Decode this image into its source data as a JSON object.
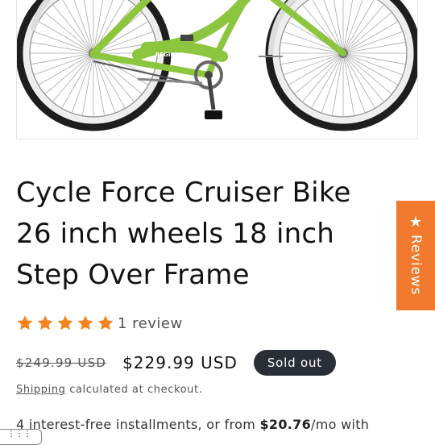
{
  "product": {
    "image_alt": "Green cruiser bicycle",
    "frame_logo": "REGIONS",
    "title": "Cycle Force Cruiser Bike 26 inch wheels 18 inch Step Over Frame",
    "rating": {
      "stars": 5,
      "max": 5,
      "review_count_label": "1 review"
    },
    "price": {
      "compare_at": "$249.99 USD",
      "sale": "$229.99 USD",
      "badge": "Sold out"
    },
    "shipping": {
      "link_label": "Shipping",
      "suffix": " calculated at checkout."
    },
    "installments": {
      "prefix": "4 interest-free installments, or from ",
      "amount": "$20.76",
      "suffix": "/mo with"
    }
  },
  "reviews_tab": {
    "icon": "star-icon",
    "label": "Reviews"
  },
  "corner_widget": {
    "icon": "grid-icon"
  },
  "colors": {
    "accent_orange": "#f17a2e",
    "star_orange": "#f5841f",
    "badge_bg": "#2a2e37",
    "bike_green": "#8cc63f"
  }
}
